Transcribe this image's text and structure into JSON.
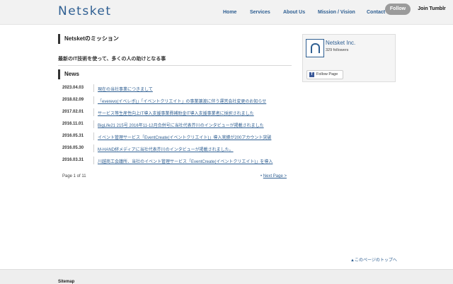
{
  "header": {
    "logo": "Netsket",
    "nav": [
      "Home",
      "Services",
      "About Us",
      "Mission / Vision",
      "Contact Us"
    ],
    "follow_label": "Follow",
    "join_label": "Join Tumblr"
  },
  "main": {
    "mission_title": "Netsketのミッション",
    "tagline": "最新のIT技術を使って、多くの人の助けとなる事",
    "news_title": "News",
    "news": [
      {
        "date": "2023.04.03",
        "title": "現在の当社事業につきまして"
      },
      {
        "date": "2018.02.09",
        "title": "「everevo(イベレボ)」「イベントクリエイト」の事業譲渡に伴う運営会社変更のお知らせ"
      },
      {
        "date": "2017.02.01",
        "title": "サービス等生産性向上IT導入支援事業費補助金IT導入支援事業者に採択されました"
      },
      {
        "date": "2016.11.01",
        "title": "BigLife21 215号 2016年11-12月合併号に当社代表芥川のインタビューが掲載されました"
      },
      {
        "date": "2016.05.31",
        "title": "イベント管理サービス「EventCreate(イベントクリエイト)」導入実績が200アカウント突破"
      },
      {
        "date": "2016.05.30",
        "title": "M-HAND絆メディアに当社代表芥川のインタビューが掲載されました。"
      },
      {
        "date": "2016.03.31",
        "title": "川越商工会議所、当社のイベント管理サービス「EventCreate(イベントクリエイト)」を導入"
      }
    ],
    "page_info": "Page 1 of 11",
    "next_page_prefix": "• ",
    "next_page": "Next Page >"
  },
  "facebook": {
    "name": "Netsket Inc.",
    "followers": "329 followers",
    "follow_button": "Follow Page"
  },
  "to_top": "▲このページのトップへ",
  "footer": {
    "sitemap": "Sitemap"
  }
}
